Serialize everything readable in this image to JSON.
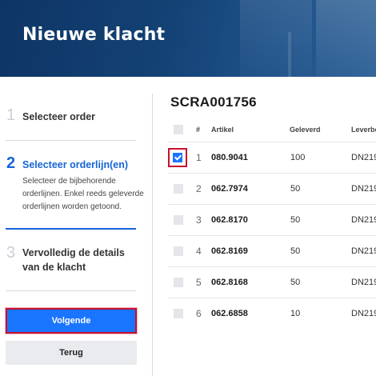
{
  "header": {
    "title": "Nieuwe klacht"
  },
  "steps": [
    {
      "number": "1",
      "title": "Selecteer order"
    },
    {
      "number": "2",
      "title": "Selecteer orderlijn(en)",
      "description": "Selecteer de bijbehorende orderlijnen. Enkel reeds geleverde orderlijnen worden getoond."
    },
    {
      "number": "3",
      "title": "Vervolledig de details van de klacht"
    }
  ],
  "buttons": {
    "next": "Volgende",
    "back": "Terug"
  },
  "order": {
    "id": "SCRA001756"
  },
  "table": {
    "columns": [
      "#",
      "Artikel",
      "Geleverd",
      "Leverbo"
    ],
    "rows": [
      {
        "num": "1",
        "artikel": "080.9041",
        "geleverd": "100",
        "lever": "DN219",
        "checked": true
      },
      {
        "num": "2",
        "artikel": "062.7974",
        "geleverd": "50",
        "lever": "DN219",
        "checked": false
      },
      {
        "num": "3",
        "artikel": "062.8170",
        "geleverd": "50",
        "lever": "DN219",
        "checked": false
      },
      {
        "num": "4",
        "artikel": "062.8169",
        "geleverd": "50",
        "lever": "DN219",
        "checked": false
      },
      {
        "num": "5",
        "artikel": "062.8168",
        "geleverd": "50",
        "lever": "DN219",
        "checked": false
      },
      {
        "num": "6",
        "artikel": "062.6858",
        "geleverd": "10",
        "lever": "DN219",
        "checked": false
      }
    ]
  },
  "colors": {
    "accent": "#1a75ff",
    "highlight": "#c8102e",
    "header": "#144275"
  }
}
